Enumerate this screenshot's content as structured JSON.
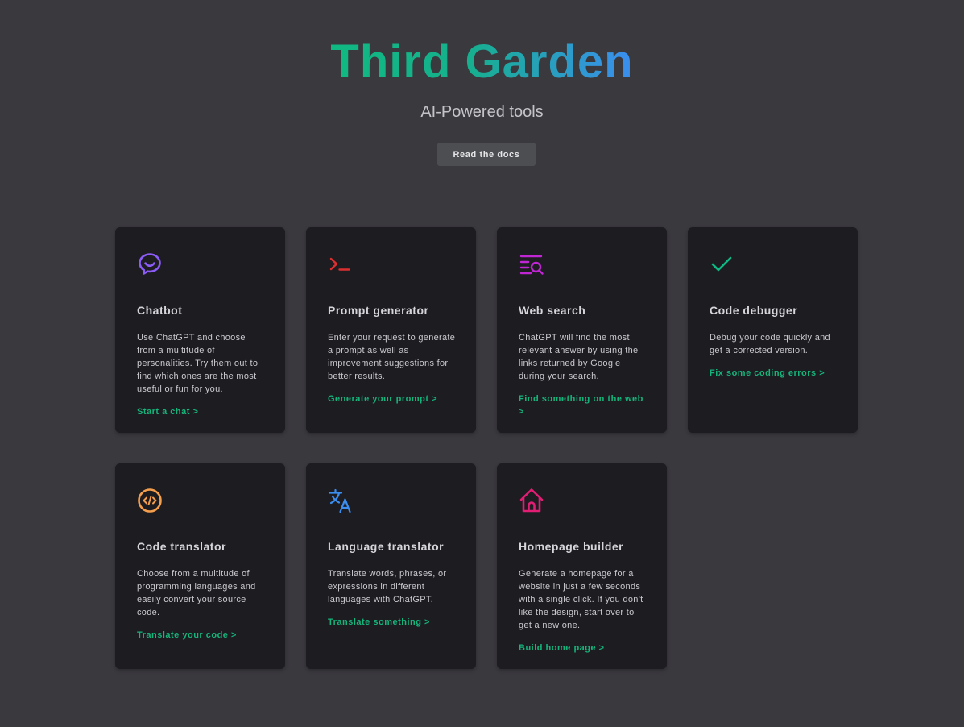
{
  "header": {
    "title": "Third Garden",
    "subtitle": "AI-Powered tools",
    "docs_button": "Read the docs"
  },
  "colors": {
    "background": "#3a393e",
    "card": "#1d1c21",
    "link": "#15b47a",
    "title_gradient_start": "#10b981",
    "title_gradient_end": "#3b8ef0"
  },
  "tools": [
    {
      "name": "Chatbot",
      "icon": "chat-bubble-icon",
      "icon_color": "#8b5cf6",
      "description": "Use ChatGPT and choose from a multitude of personalities. Try them out to find which ones are the most useful or fun for you.",
      "link": "Start a chat >"
    },
    {
      "name": "Prompt generator",
      "icon": "terminal-prompt-icon",
      "icon_color": "#dc2f2f",
      "description": "Enter your request to generate a prompt as well as improvement suggestions for better results.",
      "link": "Generate your prompt >"
    },
    {
      "name": "Web search",
      "icon": "list-search-icon",
      "icon_color": "#c026d3",
      "description": "ChatGPT will find the most relevant answer by using the links returned by Google during your search.",
      "link": "Find something on the web >"
    },
    {
      "name": "Code debugger",
      "icon": "checkmark-icon",
      "icon_color": "#10b981",
      "description": "Debug your code quickly and get a corrected version.",
      "link": "Fix some coding errors >"
    },
    {
      "name": "Code translator",
      "icon": "code-circle-icon",
      "icon_color": "#f59e4b",
      "description": "Choose from a multitude of programming languages and easily convert your source code.",
      "link": "Translate your code >"
    },
    {
      "name": "Language translator",
      "icon": "translate-icon",
      "icon_color": "#3b8ef0",
      "description": "Translate words, phrases, or expressions in different languages with ChatGPT.",
      "link": "Translate something >"
    },
    {
      "name": "Homepage builder",
      "icon": "home-icon",
      "icon_color": "#e11d74",
      "description": "Generate a homepage for a website in just a few seconds with a single click. If you don't like the design, start over to get a new one.",
      "link": "Build home page >"
    }
  ]
}
